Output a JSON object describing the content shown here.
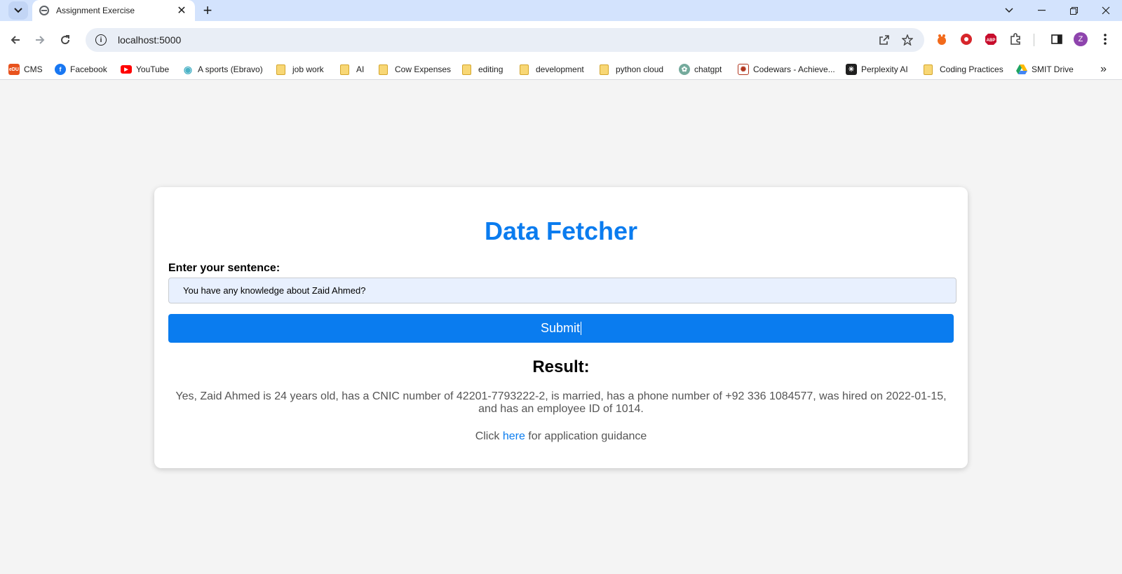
{
  "browser": {
    "tab_title": "Assignment Exercise",
    "url": "localhost:5000",
    "profile_initial": "Z"
  },
  "bookmarks": [
    {
      "label": "CMS",
      "icon": "edu-icon",
      "color": "#e8531e"
    },
    {
      "label": "Facebook",
      "icon": "facebook-icon",
      "color": "#1877f2"
    },
    {
      "label": "YouTube",
      "icon": "youtube-icon",
      "color": "#ff0000"
    },
    {
      "label": "A sports (Ebravo)",
      "icon": "eye-icon",
      "color": "#4bb2c6"
    },
    {
      "label": "job work",
      "icon": "folder-icon"
    },
    {
      "label": "AI",
      "icon": "folder-icon"
    },
    {
      "label": "Cow Expenses",
      "icon": "folder-icon"
    },
    {
      "label": "editing",
      "icon": "folder-icon"
    },
    {
      "label": "development",
      "icon": "folder-icon"
    },
    {
      "label": "python cloud",
      "icon": "folder-icon"
    },
    {
      "label": "chatgpt",
      "icon": "openai-icon",
      "color": "#74aa9c"
    },
    {
      "label": "Codewars - Achieve...",
      "icon": "codewars-icon",
      "color": "#b1361e"
    },
    {
      "label": "Perplexity AI",
      "icon": "perplexity-icon",
      "color": "#1f1f1f"
    },
    {
      "label": "Coding Practices",
      "icon": "folder-icon"
    },
    {
      "label": "SMIT Drive",
      "icon": "google-drive-icon",
      "color": "#1fa463"
    }
  ],
  "app": {
    "title": "Data Fetcher",
    "input_label": "Enter your sentence:",
    "input_value": "You have any knowledge about Zaid Ahmed?",
    "submit_label": "Submit",
    "result_heading": "Result:",
    "result_text": "Yes, Zaid Ahmed is 24 years old, has a CNIC number of 42201-7793222-2, is married, has a phone number of +92 336 1084577, was hired on 2022-01-15, and has an employee ID of 1014.",
    "guidance_prefix": "Click",
    "guidance_link": "here",
    "guidance_suffix": "for application guidance"
  },
  "colors": {
    "accent": "#0a7cef",
    "page_bg": "#f4f4f4",
    "input_bg": "#e8f0fe"
  }
}
